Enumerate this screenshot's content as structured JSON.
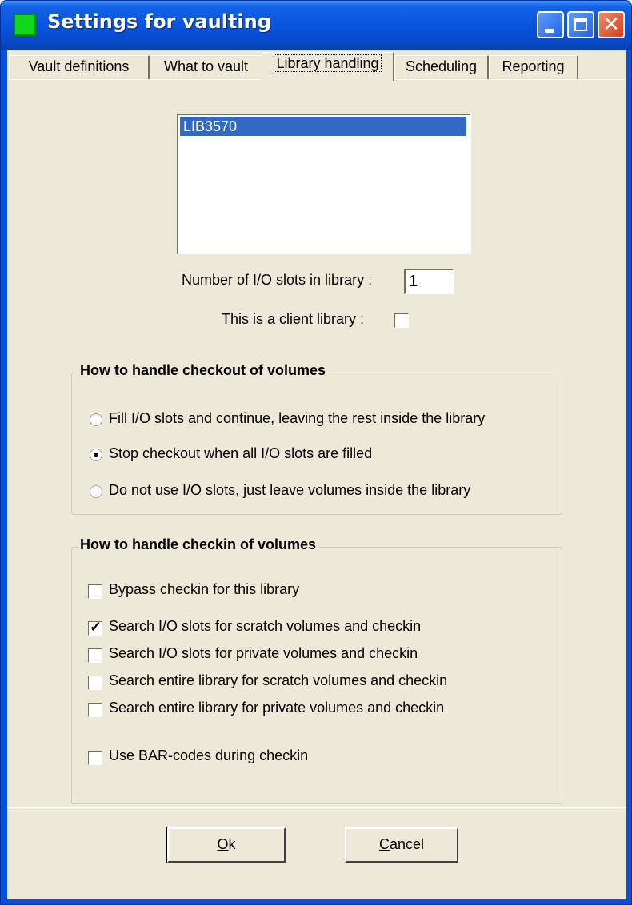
{
  "window": {
    "title": "Settings for vaulting"
  },
  "titlebar": {
    "close_glyph": "✕"
  },
  "tabs": [
    "Vault definitions",
    "What to vault",
    "Library handling",
    "Scheduling",
    "Reporting"
  ],
  "library_list": {
    "items": [
      "LIB3570"
    ],
    "selected": "LIB3570"
  },
  "io_slots": {
    "label": "Number of I/O slots in library :",
    "value": "1"
  },
  "client_library": {
    "label": "This is a client library :",
    "checked": false
  },
  "checkout_group": {
    "title": "How to handle checkout of volumes",
    "options": [
      {
        "label": "Fill I/O slots and continue, leaving the rest inside the library",
        "selected": false
      },
      {
        "label": "Stop checkout when all I/O slots are filled",
        "selected": true
      },
      {
        "label": "Do not use I/O slots, just leave volumes inside the library",
        "selected": false
      }
    ]
  },
  "checkin_group": {
    "title": "How to handle checkin of volumes",
    "options": [
      {
        "label": "Bypass checkin for this library",
        "checked": false
      },
      {
        "label": "Search I/O slots for scratch volumes and checkin",
        "checked": true
      },
      {
        "label": "Search I/O slots for private volumes and checkin",
        "checked": false
      },
      {
        "label": "Search entire library for scratch volumes and checkin",
        "checked": false
      },
      {
        "label": "Search entire library for private volumes and checkin",
        "checked": false
      },
      {
        "label": "Use BAR-codes during checkin",
        "checked": false
      }
    ]
  },
  "buttons": {
    "ok": {
      "mnemonic": "O",
      "rest": "k"
    },
    "cancel": {
      "mnemonic": "C",
      "rest": "ancel"
    }
  },
  "icons": [
    "app-icon",
    "minimize-icon",
    "maximize-icon",
    "close-icon",
    "checkmark-icon",
    "radio-dot-icon"
  ],
  "colors": {
    "titlebar": "#0a56e0",
    "dialog_face": "#ece9d8",
    "selection": "#316ac5",
    "close_button": "#d6411e"
  }
}
